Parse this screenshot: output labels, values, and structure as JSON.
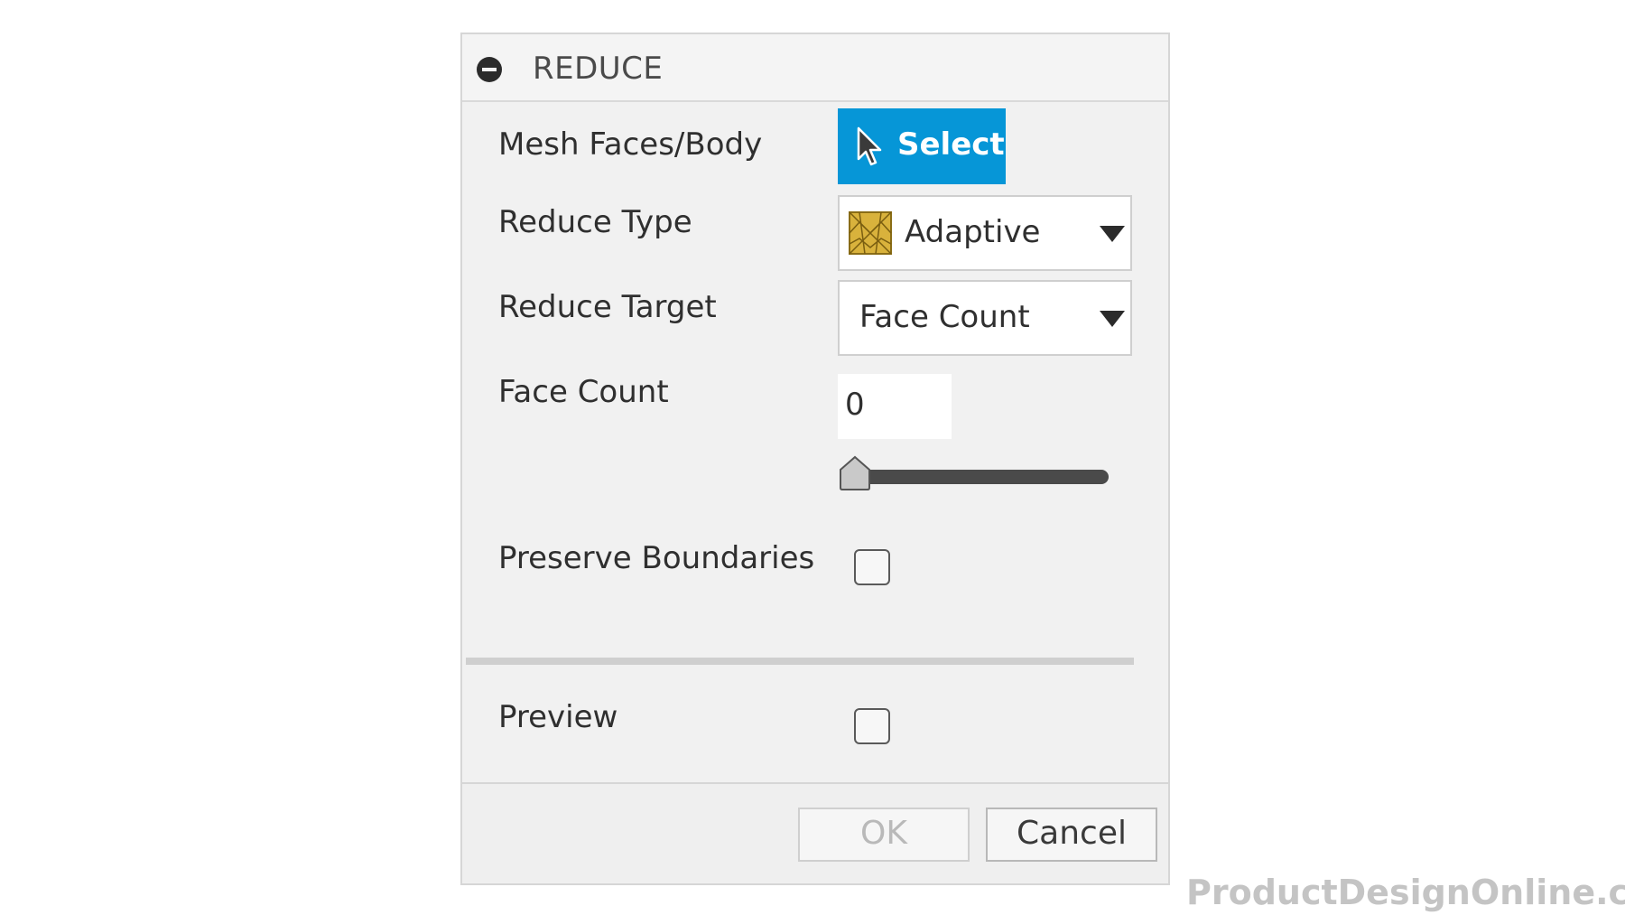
{
  "dialog": {
    "title": "REDUCE",
    "rows": {
      "mesh_faces": {
        "label": "Mesh Faces/Body",
        "button_label": "Select"
      },
      "reduce_type": {
        "label": "Reduce Type",
        "value": "Adaptive"
      },
      "reduce_target": {
        "label": "Reduce Target",
        "value": "Face Count"
      },
      "face_count": {
        "label": "Face Count",
        "value": "0",
        "slider_fraction": 0
      },
      "preserve_boundaries": {
        "label": "Preserve Boundaries",
        "checked": false
      },
      "preview": {
        "label": "Preview",
        "checked": false
      }
    },
    "footer": {
      "ok_label": "OK",
      "cancel_label": "Cancel"
    }
  },
  "watermark": "ProductDesignOnline.com",
  "colors": {
    "accent": "#0696d7",
    "adaptive_icon": "#d9b23c"
  },
  "icons": [
    "collapse-icon",
    "cursor-icon",
    "adaptive-mesh-icon",
    "chevron-down-icon",
    "slider-thumb"
  ]
}
